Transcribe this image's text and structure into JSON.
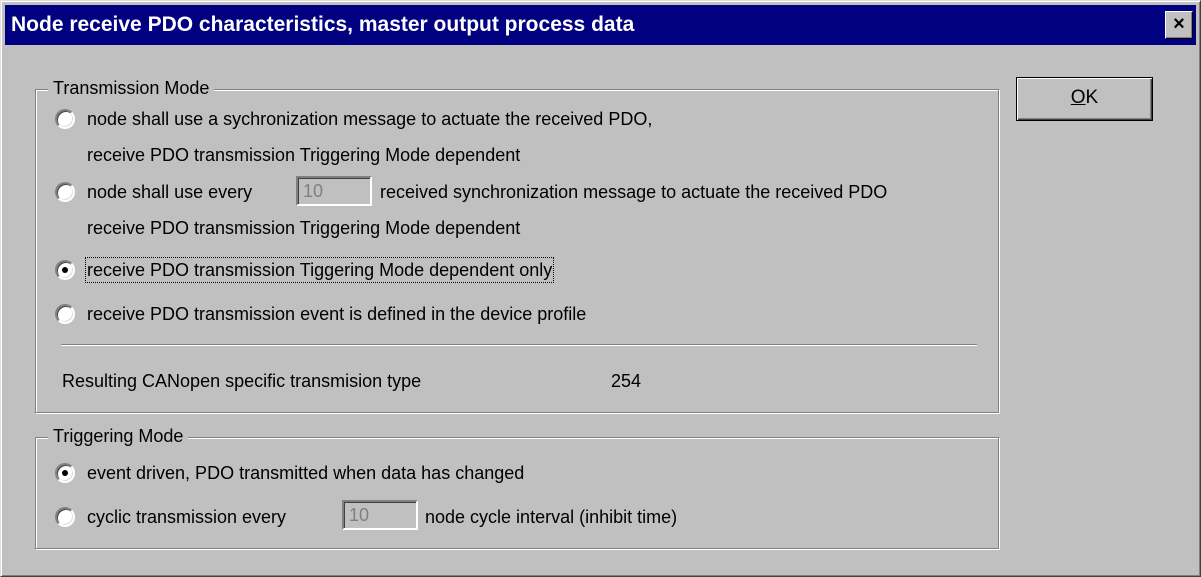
{
  "window": {
    "title": "Node receive PDO characteristics, master output process data",
    "close_glyph": "×"
  },
  "ok_button": {
    "label_first": "O",
    "label_rest": "K"
  },
  "transmission_mode": {
    "legend": "Transmission Mode",
    "options": [
      {
        "line1": "node shall use a sychronization message to actuate the received PDO,",
        "line2": "receive PDO transmission Triggering Mode dependent",
        "selected": false
      },
      {
        "line1_before": "node shall use every",
        "input_value": "10",
        "line1_after": "received synchronization message to actuate the received PDO",
        "line2": "receive PDO transmission Triggering Mode dependent",
        "selected": false
      },
      {
        "line1": "receive PDO transmission Tiggering Mode dependent only",
        "selected": true
      },
      {
        "line1": "receive PDO transmission event is defined in  the device profile",
        "selected": false
      }
    ],
    "result_label": "Resulting CANopen specific transmision type",
    "result_value": "254"
  },
  "triggering_mode": {
    "legend": "Triggering Mode",
    "options": [
      {
        "label": "event driven, PDO transmitted when data has changed",
        "selected": true
      },
      {
        "label_before": "cyclic transmission every",
        "input_value": "10",
        "label_after": "node cycle interval (inhibit time)",
        "selected": false
      }
    ]
  }
}
